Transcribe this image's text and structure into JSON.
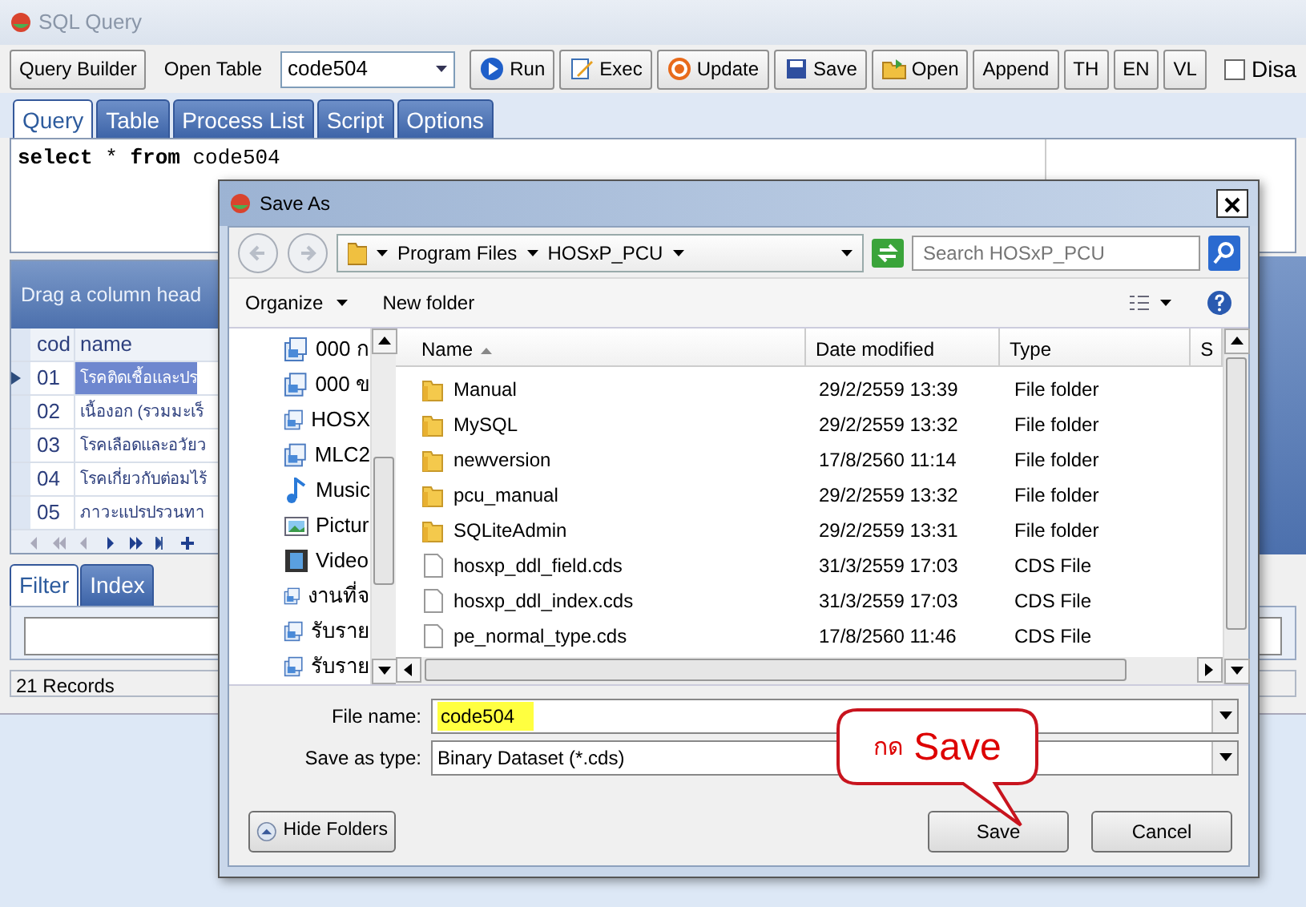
{
  "window": {
    "title": "SQL Query"
  },
  "toolbar": [
    {
      "kind": "button",
      "label": "Query Builder"
    },
    {
      "kind": "label",
      "label": "Open Table"
    },
    {
      "kind": "combo",
      "value": "code504"
    },
    {
      "kind": "icon-button",
      "label": "Run"
    },
    {
      "kind": "icon-button",
      "label": "Exec"
    },
    {
      "kind": "icon-button",
      "label": "Update"
    },
    {
      "kind": "icon-button",
      "label": "Save"
    },
    {
      "kind": "icon-button",
      "label": "Open"
    },
    {
      "kind": "button",
      "label": "Append"
    },
    {
      "kind": "button",
      "label": "TH"
    },
    {
      "kind": "button",
      "label": "EN"
    },
    {
      "kind": "button",
      "label": "VL"
    },
    {
      "kind": "checkbox",
      "label": "Disa",
      "checked": false
    }
  ],
  "tabs": [
    {
      "label": "Query",
      "selected": true
    },
    {
      "label": "Table",
      "selected": false
    },
    {
      "label": "Process List",
      "selected": false
    },
    {
      "label": "Script",
      "selected": false
    },
    {
      "label": "Options",
      "selected": false
    }
  ],
  "editor": {
    "sql": "**select** * **from** code504"
  },
  "grid": {
    "group_hint": "Drag a column head",
    "columns": [
      "cod",
      "name"
    ],
    "rows": [
      {
        "code": "01",
        "name": "โรคติดเชื้อและปร",
        "selected": true
      },
      {
        "code": "02",
        "name": "เนื้องอก (รวมมะเร็",
        "selected": false
      },
      {
        "code": "03",
        "name": "โรคเลือดและอวัยว",
        "selected": false
      },
      {
        "code": "04",
        "name": "โรคเกี่ยวกับต่อมไร้",
        "selected": false
      },
      {
        "code": "05",
        "name": "ภาวะแปรปรวนทา",
        "selected": false
      }
    ]
  },
  "filter_tabs": [
    {
      "label": "Filter",
      "selected": true
    },
    {
      "label": "Index",
      "selected": false
    }
  ],
  "status_bar": "21 Records",
  "dialog": {
    "title": "Save As",
    "breadcrumb": [
      "Program Files",
      "HOSxP_PCU"
    ],
    "search": {
      "placeholder": "Search HOSxP_PCU"
    },
    "commands": [
      "Organize",
      "New folder"
    ],
    "nav_items": [
      {
        "label": "000 ก",
        "kind": "library"
      },
      {
        "label": "000 ข",
        "kind": "library"
      },
      {
        "label": "HOSX",
        "kind": "library"
      },
      {
        "label": "MLC2",
        "kind": "library"
      },
      {
        "label": "Music",
        "kind": "music"
      },
      {
        "label": "Pictur",
        "kind": "pictures"
      },
      {
        "label": "Video",
        "kind": "video"
      },
      {
        "label": "งานที่จ",
        "kind": "library"
      },
      {
        "label": "รับราย",
        "kind": "library"
      },
      {
        "label": "รับราย",
        "kind": "library"
      }
    ],
    "columns": [
      "Name",
      "Date modified",
      "Type",
      "S"
    ],
    "files": [
      {
        "name": "Manual",
        "date": "29/2/2559 13:39",
        "type": "File folder",
        "kind": "folder"
      },
      {
        "name": "MySQL",
        "date": "29/2/2559 13:32",
        "type": "File folder",
        "kind": "folder"
      },
      {
        "name": "newversion",
        "date": "17/8/2560 11:14",
        "type": "File folder",
        "kind": "folder"
      },
      {
        "name": "pcu_manual",
        "date": "29/2/2559 13:32",
        "type": "File folder",
        "kind": "folder"
      },
      {
        "name": "SQLiteAdmin",
        "date": "29/2/2559 13:31",
        "type": "File folder",
        "kind": "folder"
      },
      {
        "name": "hosxp_ddl_field.cds",
        "date": "31/3/2559 17:03",
        "type": "CDS File",
        "kind": "file"
      },
      {
        "name": "hosxp_ddl_index.cds",
        "date": "31/3/2559 17:03",
        "type": "CDS File",
        "kind": "file"
      },
      {
        "name": "pe_normal_type.cds",
        "date": "17/8/2560 11:46",
        "type": "CDS File",
        "kind": "file"
      }
    ],
    "file_name": {
      "label": "File name:",
      "value": "code504",
      "highlighted": true
    },
    "save_type": {
      "label": "Save as type:",
      "value": "Binary Dataset (*.cds)"
    },
    "buttons": [
      "Hide Folders",
      "Save",
      "Cancel"
    ]
  },
  "callout": {
    "prefix": "กด",
    "text": "Save"
  }
}
